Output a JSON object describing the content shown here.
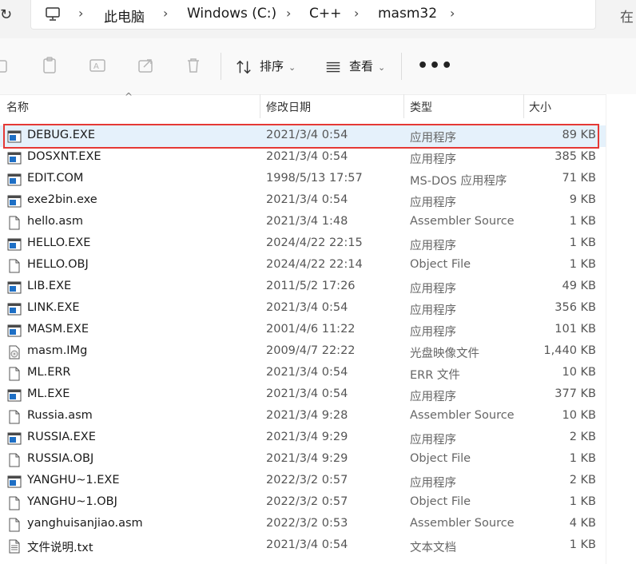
{
  "address": {
    "crumbs": [
      "此电脑",
      "Windows (C:)",
      "C++",
      "masm32"
    ],
    "search_peek": "在"
  },
  "toolbar": {
    "sort_label": "排序",
    "view_label": "查看",
    "more_label": "•••"
  },
  "columns": {
    "name": "名称",
    "date": "修改日期",
    "type": "类型",
    "size": "大小"
  },
  "files": [
    {
      "name": "DEBUG.EXE",
      "date": "2021/3/4 0:54",
      "type": "应用程序",
      "size": "89 KB",
      "icon": "exe-icon",
      "selected": true
    },
    {
      "name": "DOSXNT.EXE",
      "date": "2021/3/4 0:54",
      "type": "应用程序",
      "size": "385 KB",
      "icon": "exe-icon"
    },
    {
      "name": "EDIT.COM",
      "date": "1998/5/13 17:57",
      "type": "MS-DOS 应用程序",
      "size": "71 KB",
      "icon": "exe-icon"
    },
    {
      "name": "exe2bin.exe",
      "date": "2021/3/4 0:54",
      "type": "应用程序",
      "size": "9 KB",
      "icon": "exe-icon"
    },
    {
      "name": "hello.asm",
      "date": "2021/3/4 1:48",
      "type": "Assembler Source",
      "size": "1 KB",
      "icon": "doc-icon"
    },
    {
      "name": "HELLO.EXE",
      "date": "2024/4/22 22:15",
      "type": "应用程序",
      "size": "1 KB",
      "icon": "exe-icon"
    },
    {
      "name": "HELLO.OBJ",
      "date": "2024/4/22 22:14",
      "type": "Object File",
      "size": "1 KB",
      "icon": "doc-icon"
    },
    {
      "name": "LIB.EXE",
      "date": "2011/5/2 17:26",
      "type": "应用程序",
      "size": "49 KB",
      "icon": "exe-icon"
    },
    {
      "name": "LINK.EXE",
      "date": "2021/3/4 0:54",
      "type": "应用程序",
      "size": "356 KB",
      "icon": "exe-icon"
    },
    {
      "name": "MASM.EXE",
      "date": "2001/4/6 11:22",
      "type": "应用程序",
      "size": "101 KB",
      "icon": "exe-icon"
    },
    {
      "name": "masm.IMg",
      "date": "2009/4/7 22:22",
      "type": "光盘映像文件",
      "size": "1,440 KB",
      "icon": "disc-icon"
    },
    {
      "name": "ML.ERR",
      "date": "2021/3/4 0:54",
      "type": "ERR 文件",
      "size": "10 KB",
      "icon": "doc-icon"
    },
    {
      "name": "ML.EXE",
      "date": "2021/3/4 0:54",
      "type": "应用程序",
      "size": "377 KB",
      "icon": "exe-icon"
    },
    {
      "name": "Russia.asm",
      "date": "2021/3/4 9:28",
      "type": "Assembler Source",
      "size": "10 KB",
      "icon": "doc-icon"
    },
    {
      "name": "RUSSIA.EXE",
      "date": "2021/3/4 9:29",
      "type": "应用程序",
      "size": "2 KB",
      "icon": "exe-icon"
    },
    {
      "name": "RUSSIA.OBJ",
      "date": "2021/3/4 9:29",
      "type": "Object File",
      "size": "1 KB",
      "icon": "doc-icon"
    },
    {
      "name": "YANGHU~1.EXE",
      "date": "2022/3/2 0:57",
      "type": "应用程序",
      "size": "2 KB",
      "icon": "exe-icon"
    },
    {
      "name": "YANGHU~1.OBJ",
      "date": "2022/3/2 0:57",
      "type": "Object File",
      "size": "1 KB",
      "icon": "doc-icon"
    },
    {
      "name": "yanghuisanjiao.asm",
      "date": "2022/3/2 0:53",
      "type": "Assembler Source",
      "size": "4 KB",
      "icon": "doc-icon"
    },
    {
      "name": "文件说明.txt",
      "date": "2021/3/4 0:54",
      "type": "文本文档",
      "size": "1 KB",
      "icon": "txt-icon"
    }
  ],
  "colors": {
    "selection": "#e5f1fb",
    "highlight_border": "#e53935",
    "exe_blue": "#1e6fc5"
  }
}
